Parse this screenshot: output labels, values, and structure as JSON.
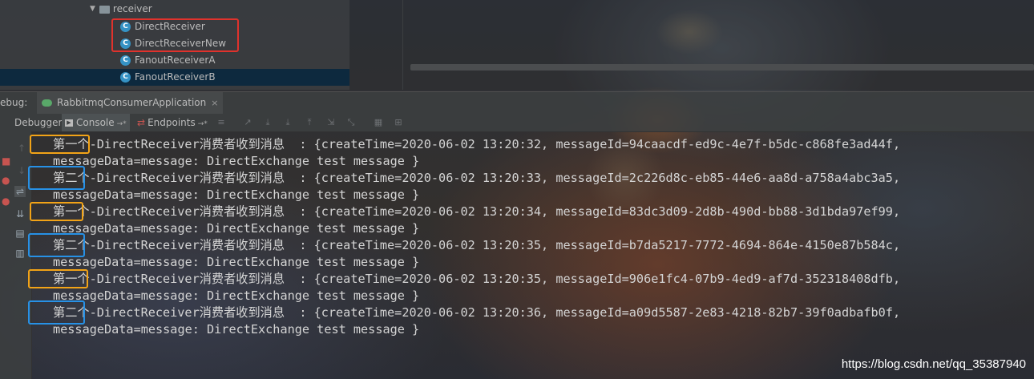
{
  "project_tree": {
    "folder": "receiver",
    "items": [
      {
        "label": "DirectReceiver"
      },
      {
        "label": "DirectReceiverNew"
      },
      {
        "label": "FanoutReceiverA"
      },
      {
        "label": "FanoutReceiverB"
      }
    ],
    "selected_index": 3,
    "class_icon_letter": "C"
  },
  "debug": {
    "label": "ebug:",
    "run_config": "RabbitmqConsumerApplication",
    "close": "×"
  },
  "toolbar": {
    "debugger_tab": "Debugger",
    "console_tab": "Console",
    "endpoints_tab": "Endpoints",
    "pin": "→*"
  },
  "console": {
    "lines": [
      {
        "tag": "第一个",
        "text": "-DirectReceiver消费者收到消息  : {createTime=2020-06-02 13:20:32, messageId=94caacdf-ed9c-4e7f-b5dc-c868fe3ad44f,",
        "cont": "messageData=message: DirectExchange test message }",
        "mark": "orange"
      },
      {
        "tag": "第二个",
        "text": "-DirectReceiver消费者收到消息  : {createTime=2020-06-02 13:20:33, messageId=2c226d8c-eb85-44e6-aa8d-a758a4abc3a5,",
        "cont": "messageData=message: DirectExchange test message }",
        "mark": "blue"
      },
      {
        "tag": "第一个",
        "text": "-DirectReceiver消费者收到消息  : {createTime=2020-06-02 13:20:34, messageId=83dc3d09-2d8b-490d-bb88-3d1bda97ef99,",
        "cont": "messageData=message: DirectExchange test message }",
        "mark": "orange"
      },
      {
        "tag": "第二个",
        "text": "-DirectReceiver消费者收到消息  : {createTime=2020-06-02 13:20:35, messageId=b7da5217-7772-4694-864e-4150e87b584c,",
        "cont": "messageData=message: DirectExchange test message }",
        "mark": "blue"
      },
      {
        "tag": "第一个",
        "text": "-DirectReceiver消费者收到消息  : {createTime=2020-06-02 13:20:35, messageId=906e1fc4-07b9-4ed9-af7d-352318408dfb,",
        "cont": "messageData=message: DirectExchange test message }",
        "mark": "orange"
      },
      {
        "tag": "第二个",
        "text": "-DirectReceiver消费者收到消息  : {createTime=2020-06-02 13:20:36, messageId=a09d5587-2e83-4218-82b7-39f0adbafb0f,",
        "cont": "messageData=message: DirectExchange test message }",
        "mark": "blue"
      }
    ]
  },
  "colors": {
    "orange_mark": "#f2a317",
    "blue_mark": "#2791e6",
    "red_box": "#e0322c"
  },
  "watermark": "https://blog.csdn.net/qq_35387940"
}
